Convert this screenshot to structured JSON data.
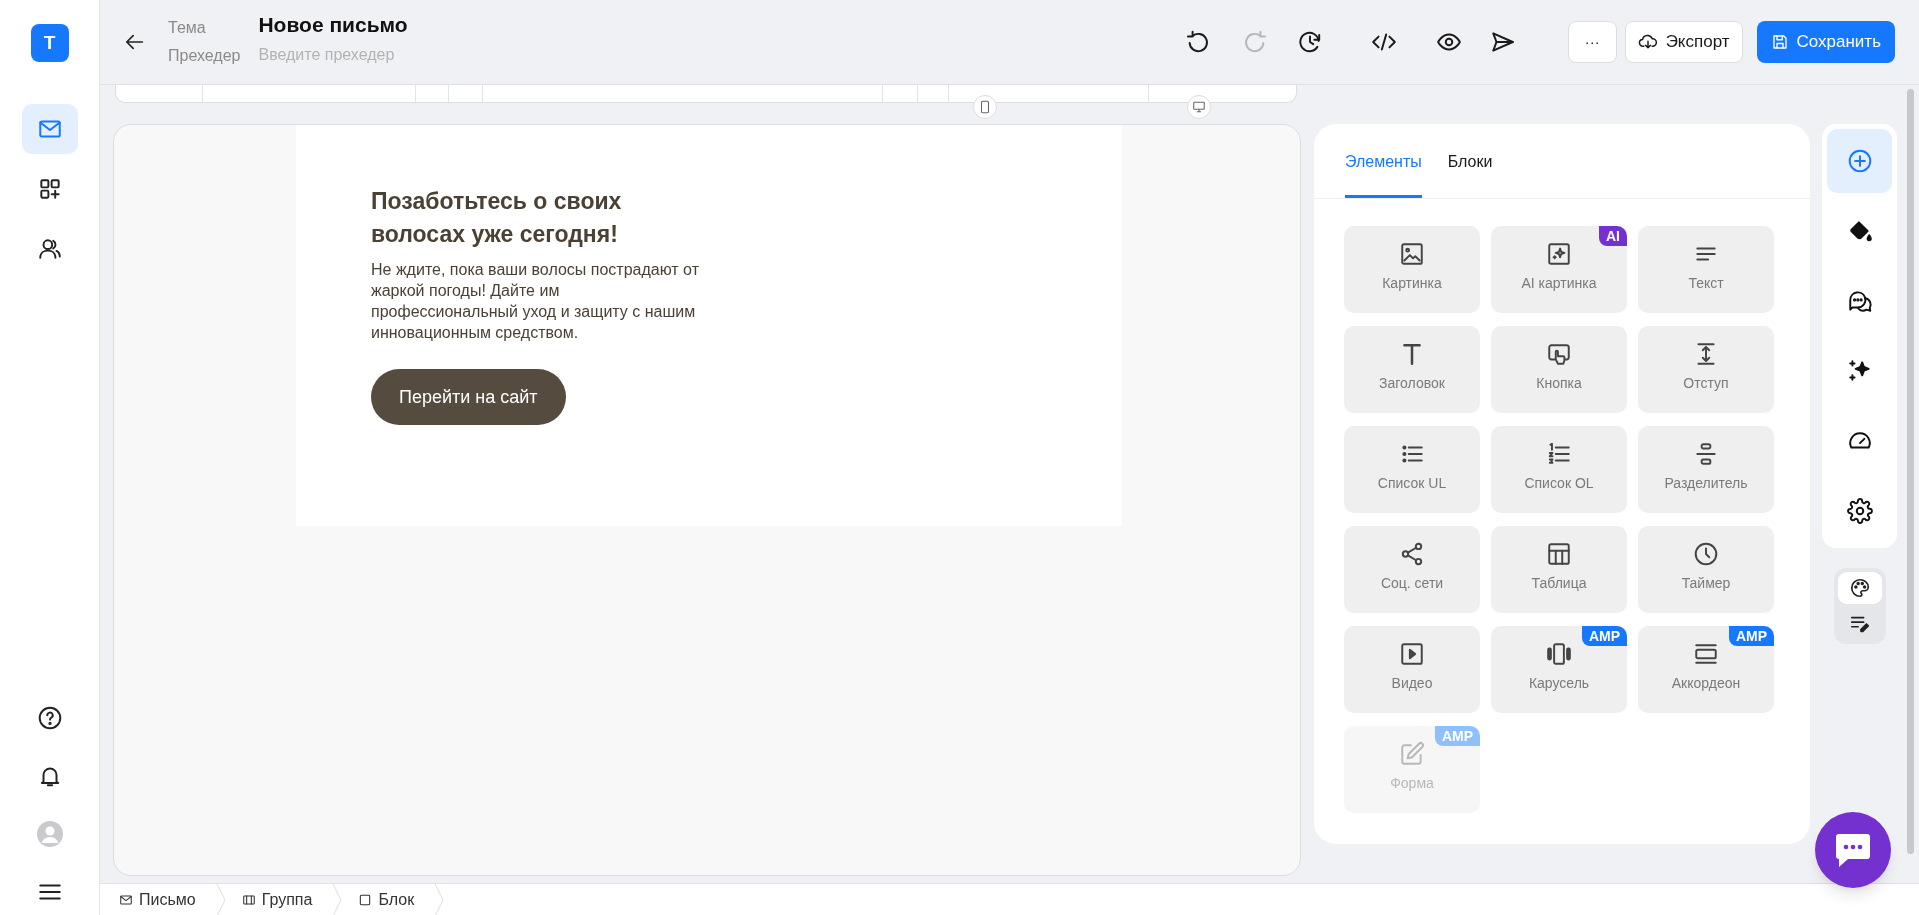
{
  "app": {
    "logo": "T"
  },
  "sidebar": {
    "items": [
      {
        "selected": true
      },
      {
        "selected": false
      },
      {
        "selected": false
      }
    ],
    "bottom_items": [
      {
        "kind": "help"
      },
      {
        "kind": "bell"
      },
      {
        "kind": "avatar"
      },
      {
        "kind": "menu"
      }
    ]
  },
  "header": {
    "subject_label": "Тема",
    "subject": "Новое письмо",
    "preheader_label": "Прехедер",
    "preheader": {
      "placeholder": "Введите прехедер"
    }
  },
  "toolbar": [
    {
      "kind": "undo",
      "disabled": false
    },
    {
      "kind": "redo",
      "disabled": true
    },
    {
      "kind": "history",
      "disabled": false
    },
    {
      "kind": "code",
      "disabled": false
    },
    {
      "kind": "preview",
      "disabled": false
    },
    {
      "kind": "send",
      "disabled": false
    }
  ],
  "actions": [
    {
      "kind": "more",
      "label": "···"
    },
    {
      "kind": "export",
      "label": "Экспорт"
    },
    {
      "kind": "save",
      "label": "Сохранить"
    }
  ],
  "canvas": {
    "heading": "Позаботьтесь о своих волосах уже сегодня!",
    "text": "Не ждите, пока ваши волосы пострадают от жаркой погоды! Дайте им профессиональный уход и защиту с нашим инновационным средством.",
    "button": "Перейти на сайт"
  },
  "panel": {
    "tabs": [
      {
        "label": "Элементы",
        "selected": true
      },
      {
        "label": "Блоки",
        "selected": false
      }
    ],
    "elements": [
      {
        "label": "Картинка",
        "disabled": false
      },
      {
        "label": "AI картинка",
        "disabled": false,
        "badge": {
          "kind": "ai",
          "text": "AI"
        }
      },
      {
        "label": "Текст",
        "disabled": false
      },
      {
        "label": "Заголовок",
        "disabled": false
      },
      {
        "label": "Кнопка",
        "disabled": false
      },
      {
        "label": "Отступ",
        "disabled": false
      },
      {
        "label": "Список UL",
        "disabled": false
      },
      {
        "label": "Список OL",
        "disabled": false
      },
      {
        "label": "Разделитель",
        "disabled": false
      },
      {
        "label": "Соц. сети",
        "disabled": false
      },
      {
        "label": "Таблица",
        "disabled": false
      },
      {
        "label": "Таймер",
        "disabled": false
      },
      {
        "label": "Видео",
        "disabled": false
      },
      {
        "label": "Карусель",
        "disabled": false,
        "badge": {
          "kind": "amp",
          "text": "AMP"
        }
      },
      {
        "label": "Аккордеон",
        "disabled": false,
        "badge": {
          "kind": "amp",
          "text": "AMP"
        }
      },
      {
        "label": "Форма",
        "disabled": true,
        "badge": {
          "kind": "amp",
          "text": "AMP"
        }
      }
    ]
  },
  "rail": [
    {
      "selected": true
    },
    {
      "selected": false
    },
    {
      "selected": false
    },
    {
      "selected": false
    },
    {
      "selected": false
    },
    {
      "selected": false
    }
  ],
  "mode_switch": [
    {
      "selected": true
    },
    {
      "selected": false
    }
  ],
  "breadcrumbs": [
    {
      "label": "Письмо"
    },
    {
      "label": "Группа"
    },
    {
      "label": "Блок"
    }
  ]
}
